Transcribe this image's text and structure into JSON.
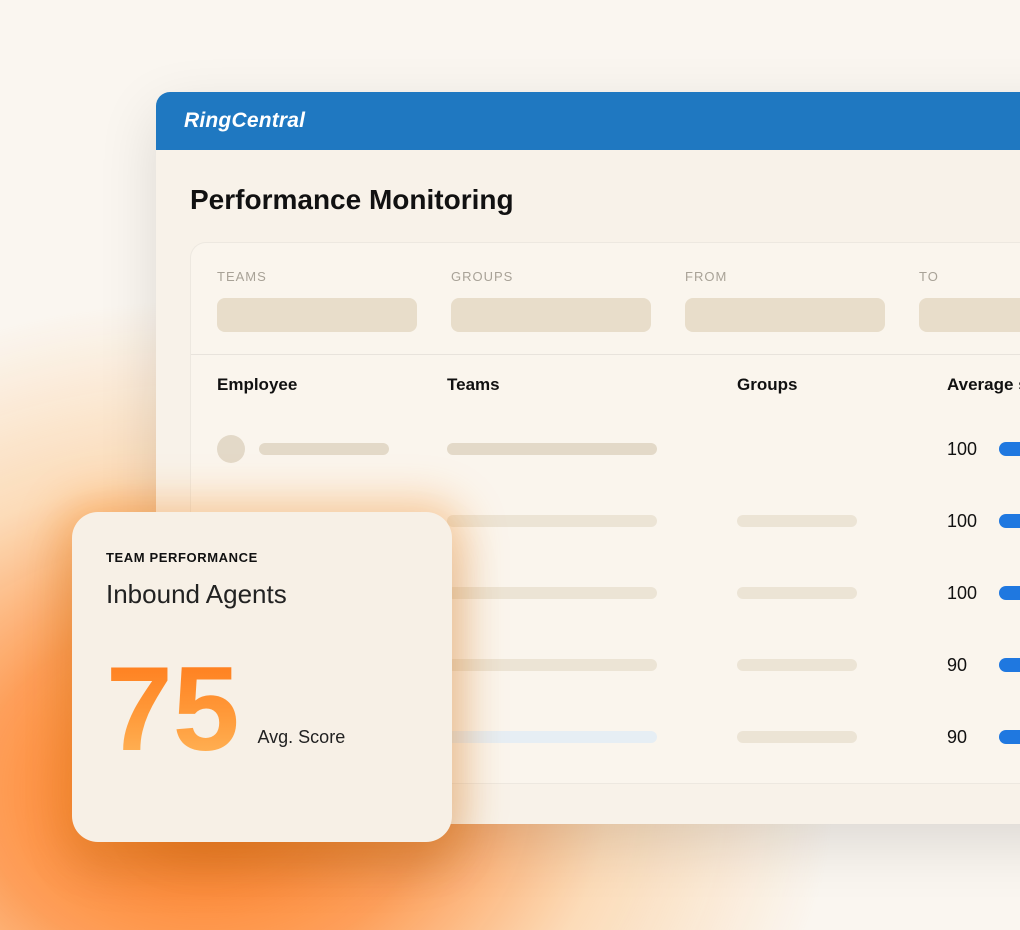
{
  "brand": "RingCentral",
  "page_title": "Performance Monitoring",
  "filters": {
    "teams_label": "TEAMS",
    "groups_label": "GROUPS",
    "from_label": "FROM",
    "to_label": "TO"
  },
  "table": {
    "headers": {
      "employee": "Employee",
      "teams": "Teams",
      "groups": "Groups",
      "avg_score": "Average score"
    },
    "rows": [
      {
        "score": 100
      },
      {
        "score": 100
      },
      {
        "score": 100
      },
      {
        "score": 90
      },
      {
        "score": 90
      }
    ]
  },
  "card": {
    "label": "TEAM PERFORMANCE",
    "title": "Inbound Agents",
    "value": "75",
    "sub": "Avg. Score"
  },
  "colors": {
    "header_blue": "#1f78c1",
    "bar_blue": "#1f78e0",
    "accent_orange": "#ff7a1a"
  }
}
